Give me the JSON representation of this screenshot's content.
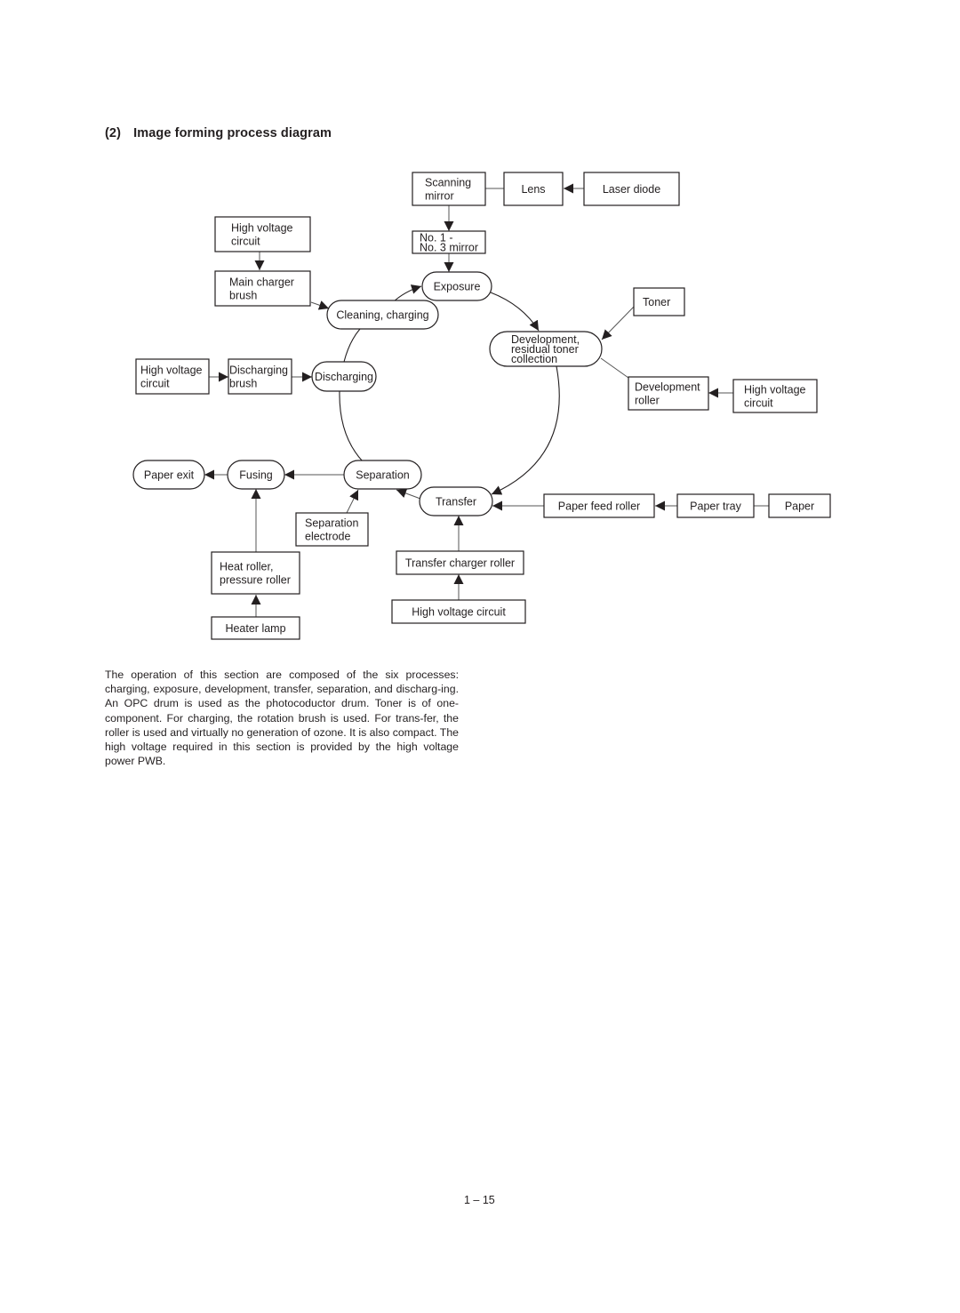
{
  "heading": {
    "number": "(2)",
    "title": "Image forming process diagram"
  },
  "diagram": {
    "nodes": {
      "scanning_mirror": [
        "Scanning",
        "mirror"
      ],
      "lens": [
        "Lens"
      ],
      "laser_diode": [
        "Laser diode"
      ],
      "mirror_1_3": [
        "No. 1 -",
        "No. 3 mirror"
      ],
      "hv_circuit_charger": [
        "High voltage",
        "circuit"
      ],
      "main_charger_brush": [
        "Main charger",
        "brush"
      ],
      "exposure": [
        "Exposure"
      ],
      "cleaning_charging": [
        "Cleaning, charging"
      ],
      "toner": [
        "Toner"
      ],
      "development": [
        "Development,",
        "residual toner",
        "collection"
      ],
      "hv_circuit_discharge": [
        "High voltage",
        "circuit"
      ],
      "discharging_brush": [
        "Discharging",
        "brush"
      ],
      "discharging": [
        "Discharging"
      ],
      "development_roller": [
        "Development",
        "roller"
      ],
      "hv_circuit_development": [
        "High voltage",
        "circuit"
      ],
      "paper_exit": [
        "Paper exit"
      ],
      "fusing": [
        "Fusing"
      ],
      "separation": [
        "Separation"
      ],
      "transfer": [
        "Transfer"
      ],
      "paper_feed_roller": [
        "Paper feed roller"
      ],
      "paper_tray": [
        "Paper tray"
      ],
      "paper": [
        "Paper"
      ],
      "separation_electrode": [
        "Separation",
        "electrode"
      ],
      "heat_roller": [
        "Heat roller,",
        "pressure roller"
      ],
      "transfer_charger_roller": [
        "Transfer charger roller"
      ],
      "heater_lamp": [
        "Heater lamp"
      ],
      "hv_circuit_transfer": [
        "High voltage circuit"
      ]
    }
  },
  "body_text": "The operation of this section are composed of the six processes: charging, exposure, development, transfer, separation, and discharg-ing. An OPC drum is used as the photocoductor drum. Toner is of one-component. For charging, the rotation brush is used. For trans-fer, the roller is used and virtually no generation of ozone. It is also compact. The high voltage required in this section is provided by the high voltage power PWB.",
  "page_number": "1 – 15"
}
